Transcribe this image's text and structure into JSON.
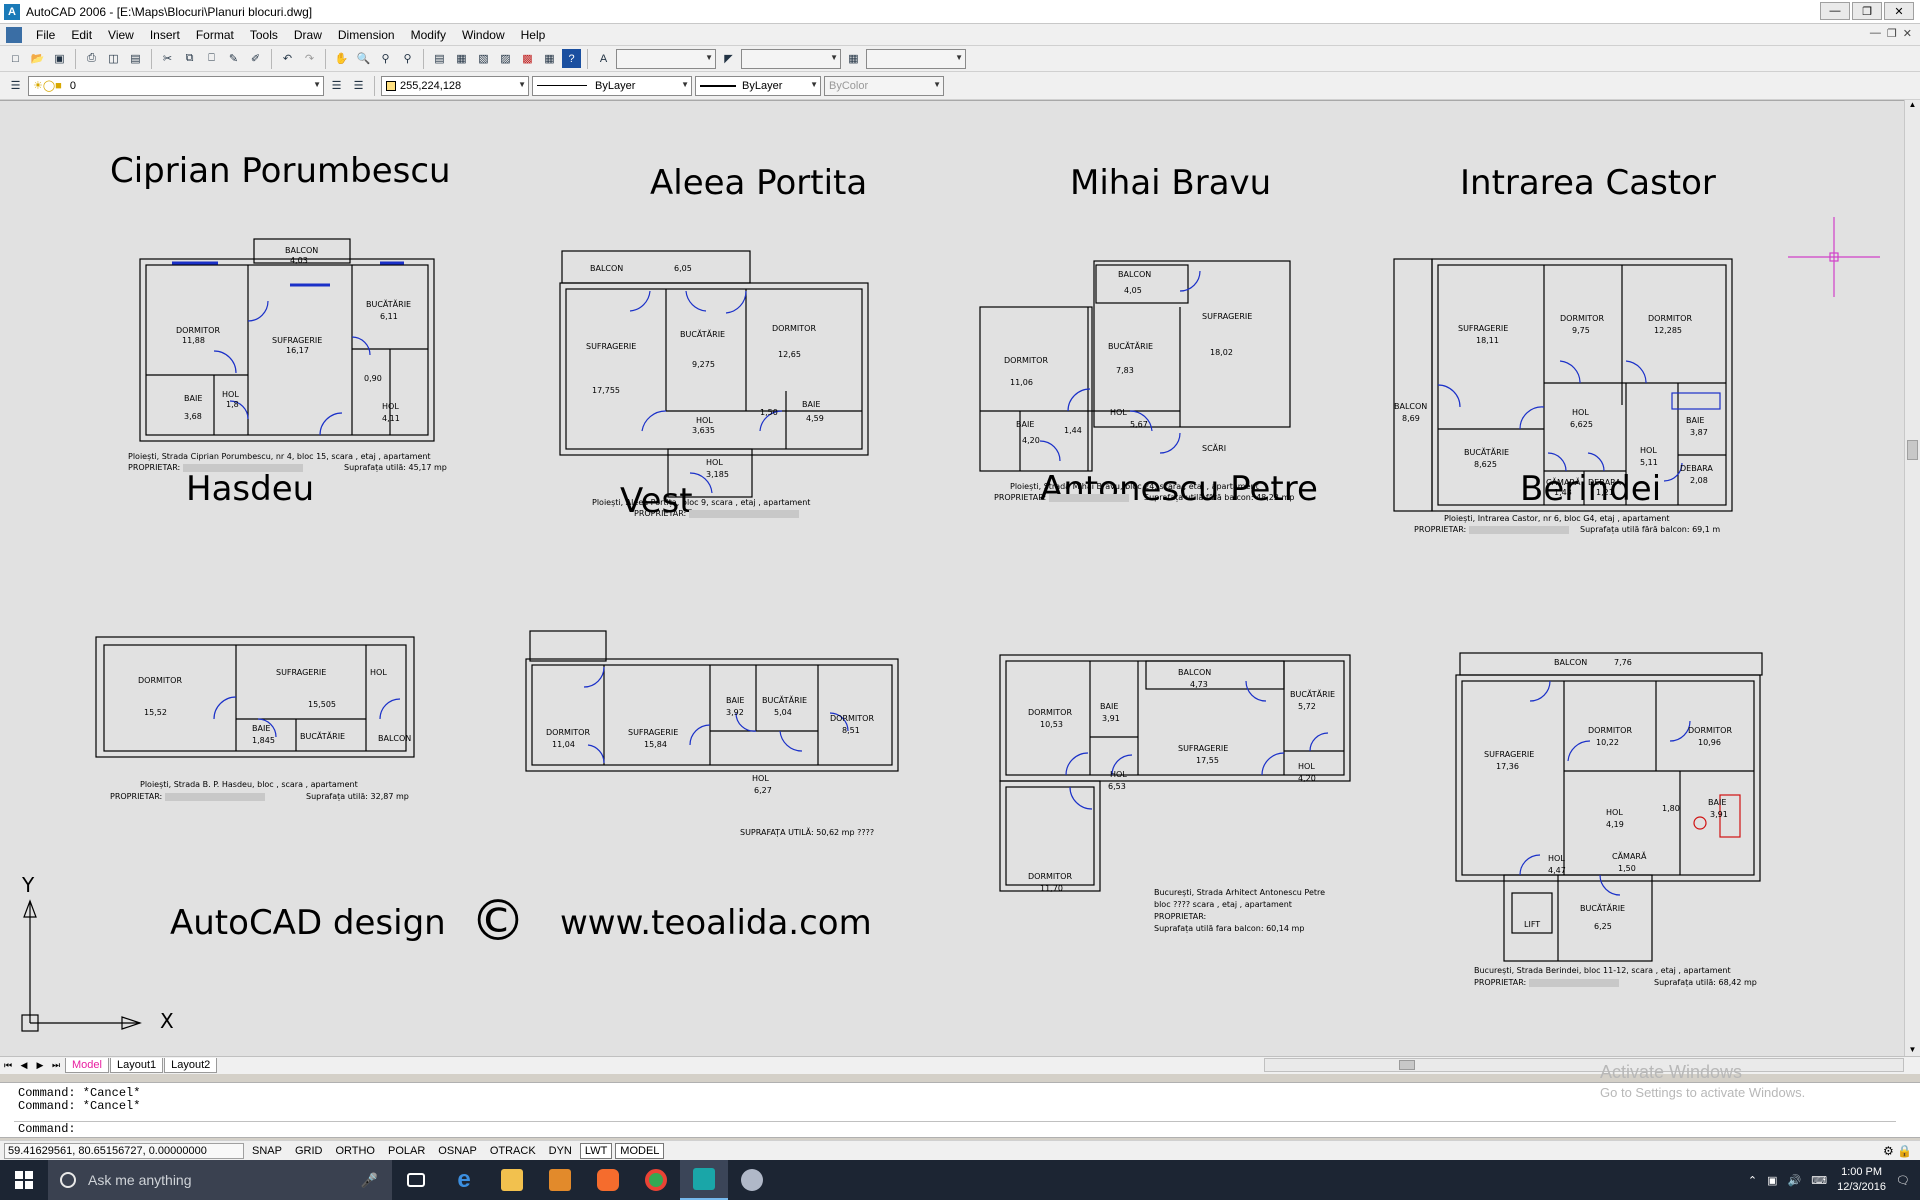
{
  "window": {
    "title": "AutoCAD 2006 - [E:\\Maps\\Blocuri\\Planuri blocuri.dwg]",
    "app_icon": "A",
    "controls": [
      "minimize-icon",
      "restore-icon",
      "close-icon"
    ]
  },
  "menu": [
    "File",
    "Edit",
    "View",
    "Insert",
    "Format",
    "Tools",
    "Draw",
    "Dimension",
    "Modify",
    "Window",
    "Help"
  ],
  "layers_toolbar": {
    "layer_value": "0",
    "color_value": "255,224,128",
    "linetype_value": "ByLayer",
    "lineweight_value": "ByLayer",
    "plotstyle_value": "ByColor"
  },
  "plans": [
    {
      "title": "Ciprian Porumbescu",
      "address": "Ploiești, Strada Ciprian Porumbescu, nr 4, bloc 15, scara , etaj , apartament",
      "owner": "PROPRIETAR:",
      "area": "Suprafața utilă: 45,17 mp",
      "rooms": [
        [
          "BALCON",
          "4,03"
        ],
        [
          "DORMITOR",
          "11,88"
        ],
        [
          "SUFRAGERIE",
          "16,17"
        ],
        [
          "BUCĂTĂRIE",
          "6,11"
        ],
        [
          "BAIE",
          "3,68"
        ],
        [
          "HOL",
          "1,8"
        ],
        [
          "HOL",
          "4,11"
        ],
        [
          "",
          "0,90"
        ]
      ]
    },
    {
      "title": "Aleea Portita",
      "address": "Ploiești, Aleea Portița, bloc 9, scara , etaj , apartament",
      "owner": "PROPRIETAR:",
      "area": "",
      "rooms": [
        [
          "BALCON",
          "6,05"
        ],
        [
          "SUFRAGERIE",
          "17,755"
        ],
        [
          "BUCĂTĂRIE",
          "9,275"
        ],
        [
          "DORMITOR",
          "12,65"
        ],
        [
          "HOL",
          "3,635"
        ],
        [
          "",
          "1,50"
        ],
        [
          "BAIE",
          "4,59"
        ],
        [
          "HOL",
          "3,185"
        ]
      ]
    },
    {
      "title": "Mihai Bravu",
      "address": "Ploiești, Strada Mihai Bravu, bloc 24, scara , etaj , apartament",
      "owner": "PROPRIETAR:",
      "area": "Suprafața utilă fără balcon: 48,22 mp",
      "rooms": [
        [
          "BALCON",
          "4,05"
        ],
        [
          "SUFRAGERIE",
          "18,02"
        ],
        [
          "DORMITOR",
          "11,06"
        ],
        [
          "BUCĂTĂRIE",
          "7,83"
        ],
        [
          "BAIE",
          "4,20"
        ],
        [
          "",
          "1,44"
        ],
        [
          "HOL",
          "5,67"
        ],
        [
          "SCĂRI",
          ""
        ]
      ]
    },
    {
      "title": "Intrarea Castor",
      "address": "Ploiești, Intrarea Castor, nr 6, bloc G4, etaj , apartament",
      "owner": "PROPRIETAR:",
      "area": "Suprafața utilă fără balcon: 69,1 m",
      "rooms": [
        [
          "SUFRAGERIE",
          "18,11"
        ],
        [
          "DORMITOR",
          "9,75"
        ],
        [
          "DORMITOR",
          "12,285"
        ],
        [
          "BALCON",
          "8,69"
        ],
        [
          "HOL",
          "6,625"
        ],
        [
          "BAIE",
          "3,87"
        ],
        [
          "BUCĂTĂRIE",
          "8,625"
        ],
        [
          "HOL",
          "5,11"
        ],
        [
          "CĂMARĂ",
          "1,43"
        ],
        [
          "DEBARA",
          "1,21"
        ],
        [
          "DEBARA",
          "2,08"
        ]
      ]
    },
    {
      "title": "Hasdeu",
      "address": "Ploiești, Strada B. P. Hasdeu, bloc , scara , apartament",
      "owner": "PROPRIETAR:",
      "area": "Suprafața utilă: 32,87 mp",
      "rooms": [
        [
          "DORMITOR",
          "15,52"
        ],
        [
          "SUFRAGERIE",
          "15,505"
        ],
        [
          "HOL",
          ""
        ],
        [
          "BAIE",
          "1,845"
        ],
        [
          "BUCĂTĂRIE",
          ""
        ],
        [
          "BALCON",
          ""
        ]
      ]
    },
    {
      "title": "Vest",
      "address": "",
      "owner": "",
      "area": "SUPRAFAȚA UTILĂ: 50,62 mp ????",
      "rooms": [
        [
          "DORMITOR",
          "11,04"
        ],
        [
          "SUFRAGERIE",
          "15,84"
        ],
        [
          "BAIE",
          "3,92"
        ],
        [
          "BUCĂTĂRIE",
          "5,04"
        ],
        [
          "DORMITOR",
          "8,51"
        ],
        [
          "HOL",
          "6,27"
        ]
      ]
    },
    {
      "title": "Antonescu Petre",
      "address": "București, Strada Arhitect Antonescu Petre",
      "address2": "bloc ???? scara , etaj , apartament",
      "owner": "PROPRIETAR:",
      "area": "Suprafața utilă fara balcon: 60,14 mp",
      "rooms": [
        [
          "BALCON",
          "4,73"
        ],
        [
          "DORMITOR",
          "10,53"
        ],
        [
          "BAIE",
          "3,91"
        ],
        [
          "BUCĂTĂRIE",
          "5,72"
        ],
        [
          "SUFRAGERIE",
          "17,55"
        ],
        [
          "HOL",
          "6,53"
        ],
        [
          "HOL",
          "4,20"
        ],
        [
          "DORMITOR",
          "11,70"
        ]
      ]
    },
    {
      "title": "Berindei",
      "address": "București, Strada Berindei, bloc 11-12, scara , etaj , apartament",
      "owner": "PROPRIETAR:",
      "area": "Suprafața utilă: 68,42 mp",
      "rooms": [
        [
          "BALCON",
          "7,76"
        ],
        [
          "SUFRAGERIE",
          "17,36"
        ],
        [
          "DORMITOR",
          "10,22"
        ],
        [
          "DORMITOR",
          "10,96"
        ],
        [
          "HOL",
          "4,19"
        ],
        [
          "",
          "1,80"
        ],
        [
          "BAIE",
          "3,91"
        ],
        [
          "HOL",
          "4,47"
        ],
        [
          "CĂMARĂ",
          "1,50"
        ],
        [
          "LIFT",
          ""
        ],
        [
          "BUCĂTĂRIE",
          "6,25"
        ]
      ]
    }
  ],
  "footer": {
    "brand": "AutoCAD design",
    "copyright": "©",
    "url": "www.teoalida.com"
  },
  "ucs": {
    "y": "Y",
    "x": "X"
  },
  "layout_tabs": [
    "Model",
    "Layout1",
    "Layout2"
  ],
  "command_lines": [
    "Command: *Cancel*",
    "Command: *Cancel*",
    "Command:"
  ],
  "watermark": {
    "line1": "Activate Windows",
    "line2": "Go to Settings to activate Windows."
  },
  "status": {
    "coords": "59.41629561, 80.65156727, 0.00000000",
    "buttons": [
      "SNAP",
      "GRID",
      "ORTHO",
      "POLAR",
      "OSNAP",
      "OTRACK",
      "DYN",
      "LWT",
      "MODEL"
    ],
    "active": [
      "LWT",
      "MODEL"
    ]
  },
  "taskbar": {
    "search_placeholder": "Ask me anything",
    "time": "1:00 PM",
    "date": "12/3/2016"
  },
  "colors": {
    "canvas": "#e1e1e1",
    "window_blue": "#1a30c8",
    "crosshair": "#d040c8",
    "accent_tab": "#e81ea0"
  }
}
